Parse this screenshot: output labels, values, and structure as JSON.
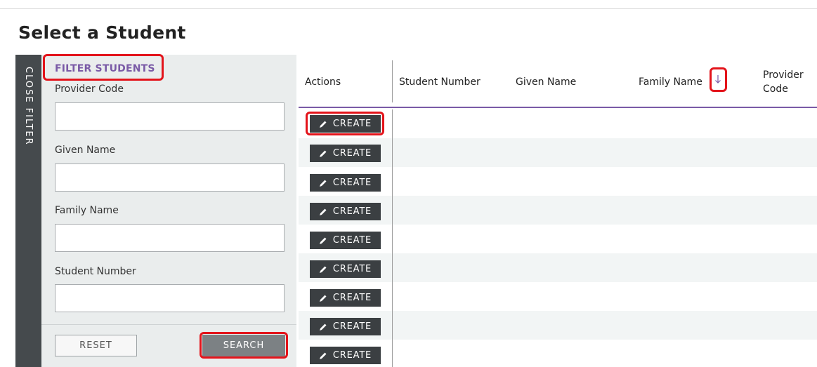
{
  "page": {
    "title": "Select a Student"
  },
  "sidebar": {
    "close_label": "CLOSE FILTER"
  },
  "filter": {
    "title": "FILTER STUDENTS",
    "fields": [
      {
        "label": "Provider Code",
        "value": ""
      },
      {
        "label": "Given Name",
        "value": ""
      },
      {
        "label": "Family Name",
        "value": ""
      },
      {
        "label": "Student Number",
        "value": ""
      }
    ],
    "reset_label": "RESET",
    "search_label": "SEARCH"
  },
  "table": {
    "columns": [
      "Actions",
      "Student Number",
      "Given Name",
      "Family Name",
      "Provider Code"
    ],
    "sort_icon": "arrow-down-icon",
    "row_action_label": "CREATE",
    "row_action_icon": "pencil-icon",
    "row_count": 9
  },
  "colors": {
    "accent_purple": "#7a5aa6",
    "dark_button": "#3b3f42",
    "panel_bg": "#eaeded",
    "highlight_red": "#e3141b"
  }
}
